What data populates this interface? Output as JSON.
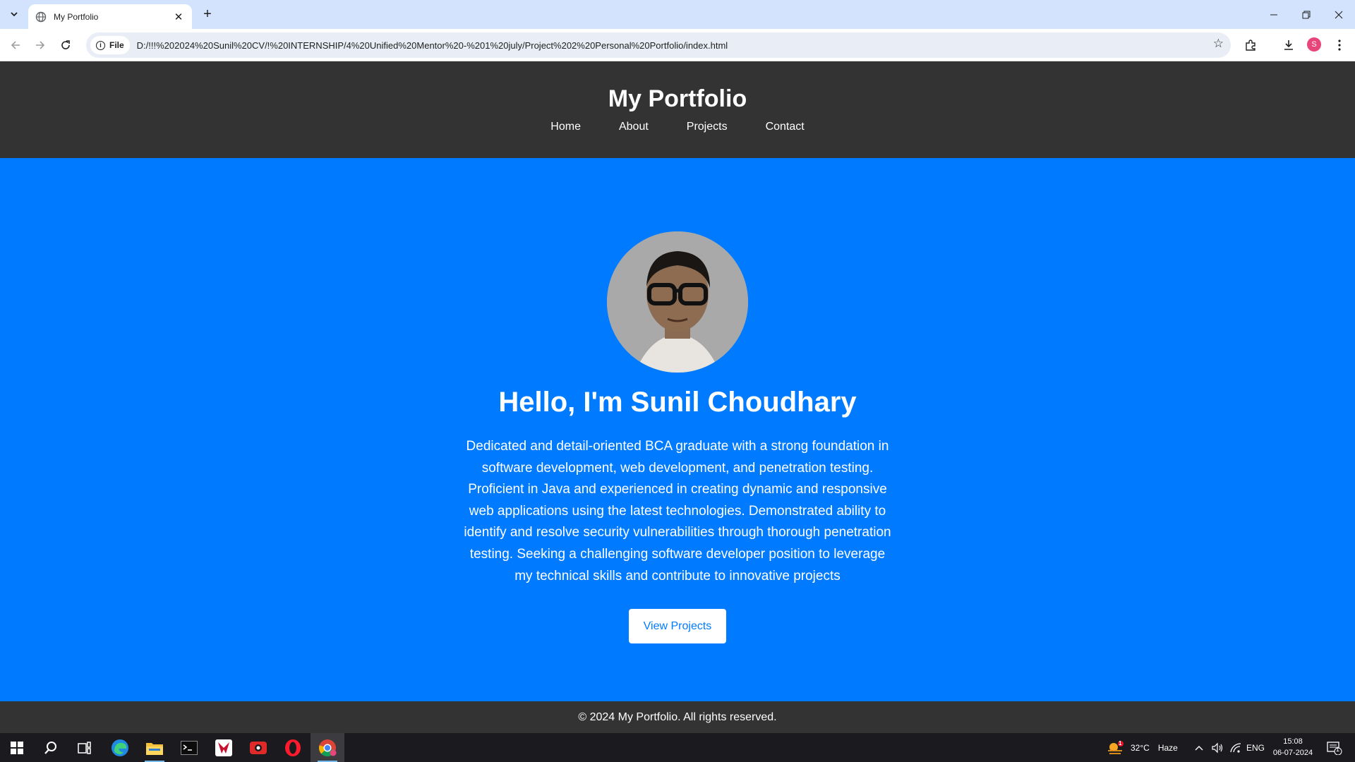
{
  "browser": {
    "tab_title": "My Portfolio",
    "url_chip": "File",
    "url": "D:/!!!%202024%20Sunil%20CV/!%20INTERNSHIP/4%20Unified%20Mentor%20-%201%20july/Project%202%20Personal%20Portfolio/index.html",
    "profile_initial": "S"
  },
  "site": {
    "title": "My Portfolio",
    "nav": [
      "Home",
      "About",
      "Projects",
      "Contact"
    ],
    "hero_title": "Hello, I'm Sunil Choudhary",
    "hero_text": "Dedicated and detail-oriented BCA graduate with a strong foundation in software development, web development, and penetration testing. Proficient in Java and experienced in creating dynamic and responsive web applications using the latest technologies. Demonstrated ability to identify and resolve security vulnerabilities through thorough penetration testing. Seeking a challenging software developer position to leverage my technical skills and contribute to innovative projects",
    "hero_button": "View Projects",
    "footer": "© 2024 My Portfolio. All rights reserved.",
    "colors": {
      "header_bg": "#333333",
      "hero_bg": "#007bff",
      "button_text": "#007bff"
    }
  },
  "taskbar": {
    "weather_temp": "32°C",
    "weather_desc": "Haze",
    "weather_badge": "1",
    "language": "ENG",
    "time": "15:08",
    "date": "06-07-2024",
    "notification_count": "1",
    "apps": [
      "start-icon",
      "search-icon",
      "task-view-icon",
      "edge-icon",
      "file-explorer-icon",
      "terminal-icon",
      "game-icon",
      "recorder-icon",
      "opera-icon",
      "chrome-icon"
    ]
  }
}
